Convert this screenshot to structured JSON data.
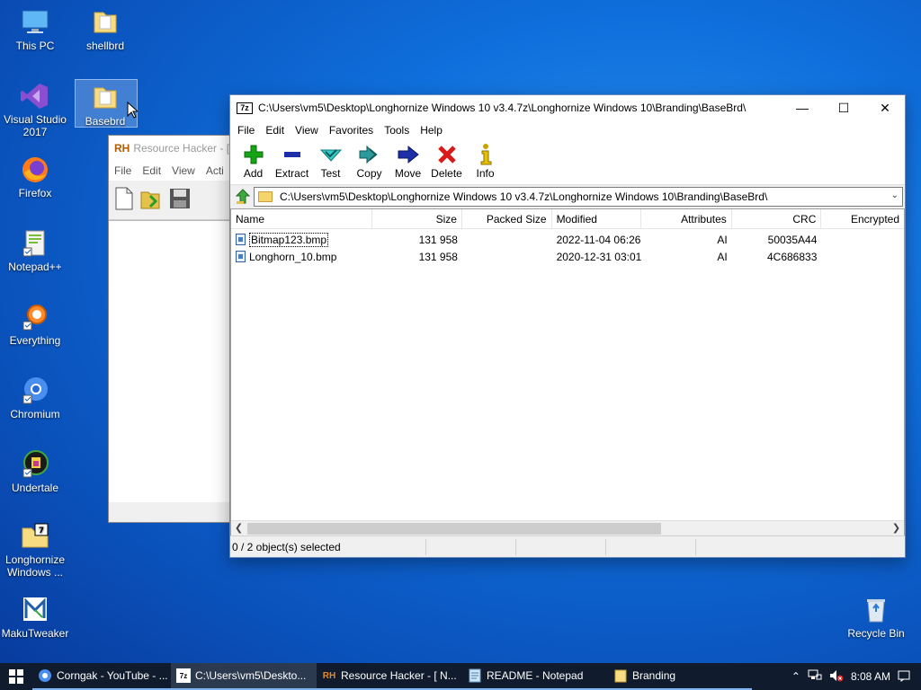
{
  "desktop": {
    "icons": [
      {
        "label": "This PC"
      },
      {
        "label": "shellbrd"
      },
      {
        "label": "Visual Studio 2017"
      },
      {
        "label": "Basebrd"
      },
      {
        "label": "Firefox"
      },
      {
        "label": "Notepad++"
      },
      {
        "label": "Everything"
      },
      {
        "label": "Chromium"
      },
      {
        "label": "Undertale"
      },
      {
        "label": "Longhornize Windows ..."
      },
      {
        "label": "MakuTweaker"
      },
      {
        "label": "Recycle Bin"
      }
    ]
  },
  "rh_window": {
    "logo": "RH",
    "title": "Resource Hacker - [",
    "menu": [
      "File",
      "Edit",
      "View",
      "Acti"
    ]
  },
  "zip_window": {
    "logo": "7z",
    "title": "C:\\Users\\vm5\\Desktop\\Longhornize Windows 10 v3.4.7z\\Longhornize Windows 10\\Branding\\BaseBrd\\",
    "controls": {
      "minimize": "—",
      "maximize": "☐",
      "close": "✕"
    },
    "menu": [
      "File",
      "Edit",
      "View",
      "Favorites",
      "Tools",
      "Help"
    ],
    "toolbar": [
      {
        "label": "Add",
        "icon": "plus-icon",
        "color": "#16a316"
      },
      {
        "label": "Extract",
        "icon": "minus-icon",
        "color": "#1d2fa8"
      },
      {
        "label": "Test",
        "icon": "check-icon",
        "color": "#18b3b3"
      },
      {
        "label": "Copy",
        "icon": "double-arrow-icon",
        "color": "#1f7f7f"
      },
      {
        "label": "Move",
        "icon": "arrow-right-icon",
        "color": "#1d2fa8"
      },
      {
        "label": "Delete",
        "icon": "x-icon",
        "color": "#d81a1a"
      },
      {
        "label": "Info",
        "icon": "info-icon",
        "color": "#c9a300"
      }
    ],
    "address": "C:\\Users\\vm5\\Desktop\\Longhornize Windows 10 v3.4.7z\\Longhornize Windows 10\\Branding\\BaseBrd\\",
    "columns": [
      "Name",
      "Size",
      "Packed Size",
      "Modified",
      "Attributes",
      "CRC",
      "Encrypted"
    ],
    "rows": [
      {
        "name": "Bitmap123.bmp",
        "size": "131 958",
        "packed": "",
        "modified": "2022-11-04 06:26",
        "attributes": "AI",
        "crc": "50035A44",
        "encrypted": ""
      },
      {
        "name": "Longhorn_10.bmp",
        "size": "131 958",
        "packed": "",
        "modified": "2020-12-31 03:01",
        "attributes": "AI",
        "crc": "4C686833",
        "encrypted": ""
      }
    ],
    "status": "0 / 2 object(s) selected"
  },
  "taskbar": {
    "items": [
      {
        "label": "Corngak - YouTube - ...",
        "icon": "chromium-icon"
      },
      {
        "label": "C:\\Users\\vm5\\Deskto...",
        "icon": "sevenzip-icon"
      },
      {
        "label": "Resource Hacker - [ N...",
        "icon": "resource-hacker-icon"
      },
      {
        "label": "README - Notepad",
        "icon": "notepad-icon"
      },
      {
        "label": "Branding",
        "icon": "folder-icon"
      }
    ],
    "time": "8:08 AM"
  }
}
